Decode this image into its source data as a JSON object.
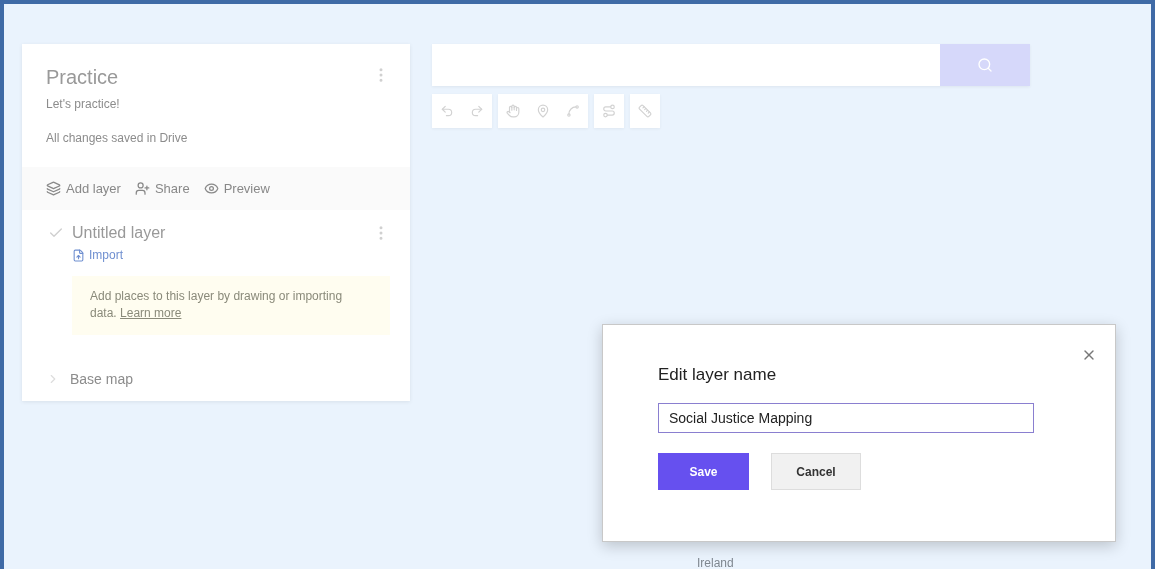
{
  "map": {
    "place_label": "Ireland"
  },
  "panel": {
    "title": "Practice",
    "description": "Let's practice!",
    "save_status": "All changes saved in Drive",
    "actions": [
      {
        "label": "Add layer"
      },
      {
        "label": "Share"
      },
      {
        "label": "Preview"
      }
    ],
    "layers": [
      {
        "name": "Untitled layer",
        "checked": true,
        "import_link": "Import",
        "hint": "Add places to this layer by drawing or importing data.",
        "hint_link": "Learn more"
      }
    ],
    "base_map": {
      "label": "Base map"
    }
  },
  "dialog": {
    "title": "Edit layer name",
    "value": "Social Justice Mapping",
    "buttons": [
      {
        "label": "Save",
        "kind": "primary"
      },
      {
        "label": "Cancel",
        "kind": "secondary"
      }
    ]
  }
}
